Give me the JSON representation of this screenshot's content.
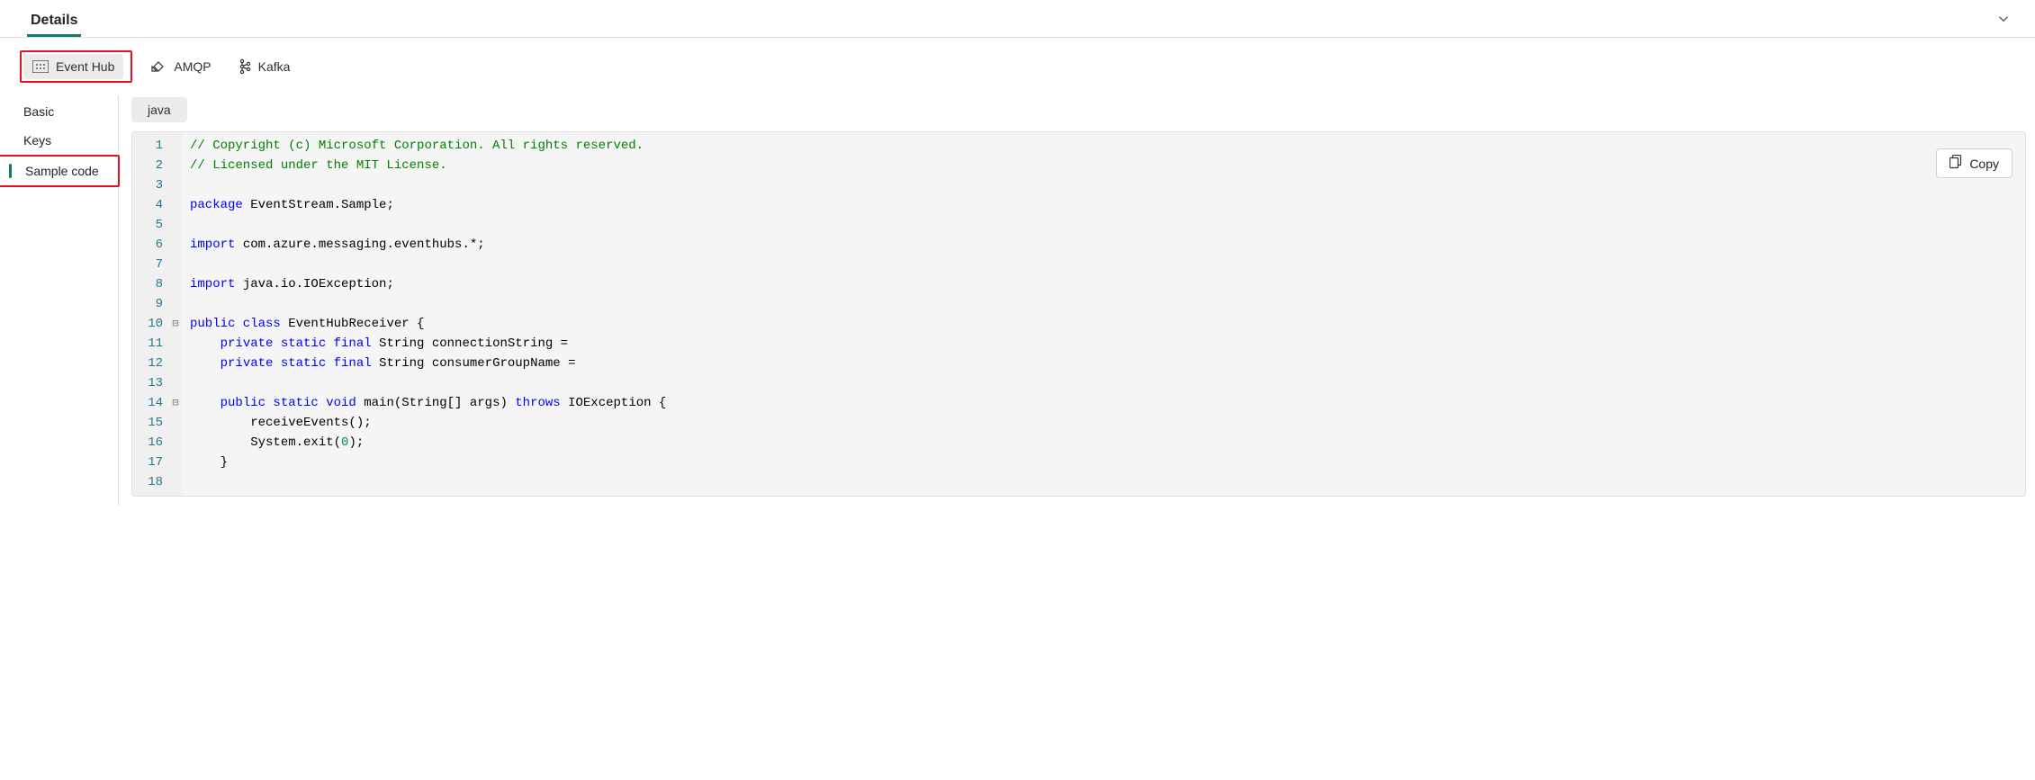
{
  "header": {
    "tab_title": "Details"
  },
  "protocols": {
    "items": [
      {
        "label": "Event Hub",
        "icon": "eventhub-icon",
        "active": true
      },
      {
        "label": "AMQP",
        "icon": "amqp-icon",
        "active": false
      },
      {
        "label": "Kafka",
        "icon": "kafka-icon",
        "active": false
      }
    ]
  },
  "sidebar": {
    "items": [
      {
        "label": "Basic",
        "selected": false
      },
      {
        "label": "Keys",
        "selected": false
      },
      {
        "label": "Sample code",
        "selected": true
      }
    ]
  },
  "content": {
    "language_chip": "java",
    "copy_label": "Copy"
  },
  "code": {
    "lines": [
      {
        "n": 1,
        "fold": "",
        "tokens": [
          [
            "comment",
            "// Copyright (c) Microsoft Corporation. All rights reserved."
          ]
        ]
      },
      {
        "n": 2,
        "fold": "",
        "tokens": [
          [
            "comment",
            "// Licensed under the MIT License."
          ]
        ]
      },
      {
        "n": 3,
        "fold": "",
        "tokens": []
      },
      {
        "n": 4,
        "fold": "",
        "tokens": [
          [
            "keyword",
            "package"
          ],
          [
            "plain",
            " EventStream.Sample;"
          ]
        ]
      },
      {
        "n": 5,
        "fold": "",
        "tokens": []
      },
      {
        "n": 6,
        "fold": "",
        "tokens": [
          [
            "keyword",
            "import"
          ],
          [
            "plain",
            " com.azure.messaging.eventhubs.*;"
          ]
        ]
      },
      {
        "n": 7,
        "fold": "",
        "tokens": []
      },
      {
        "n": 8,
        "fold": "",
        "tokens": [
          [
            "keyword",
            "import"
          ],
          [
            "plain",
            " java.io.IOException;"
          ]
        ]
      },
      {
        "n": 9,
        "fold": "",
        "tokens": []
      },
      {
        "n": 10,
        "fold": "⊟",
        "tokens": [
          [
            "keyword",
            "public class"
          ],
          [
            "plain",
            " EventHubReceiver {"
          ]
        ]
      },
      {
        "n": 11,
        "fold": "",
        "tokens": [
          [
            "plain",
            "    "
          ],
          [
            "keyword",
            "private static final"
          ],
          [
            "plain",
            " String connectionString ="
          ]
        ]
      },
      {
        "n": 12,
        "fold": "",
        "tokens": [
          [
            "plain",
            "    "
          ],
          [
            "keyword",
            "private static final"
          ],
          [
            "plain",
            " String consumerGroupName ="
          ]
        ]
      },
      {
        "n": 13,
        "fold": "",
        "tokens": []
      },
      {
        "n": 14,
        "fold": "⊟",
        "tokens": [
          [
            "plain",
            "    "
          ],
          [
            "keyword",
            "public static void"
          ],
          [
            "plain",
            " main(String[] args) "
          ],
          [
            "keyword",
            "throws"
          ],
          [
            "plain",
            " IOException {"
          ]
        ]
      },
      {
        "n": 15,
        "fold": "",
        "tokens": [
          [
            "plain",
            "        receiveEvents();"
          ]
        ]
      },
      {
        "n": 16,
        "fold": "",
        "tokens": [
          [
            "plain",
            "        System.exit("
          ],
          [
            "num",
            "0"
          ],
          [
            "plain",
            ");"
          ]
        ]
      },
      {
        "n": 17,
        "fold": "",
        "tokens": [
          [
            "plain",
            "    }"
          ]
        ]
      },
      {
        "n": 18,
        "fold": "",
        "tokens": []
      }
    ]
  }
}
